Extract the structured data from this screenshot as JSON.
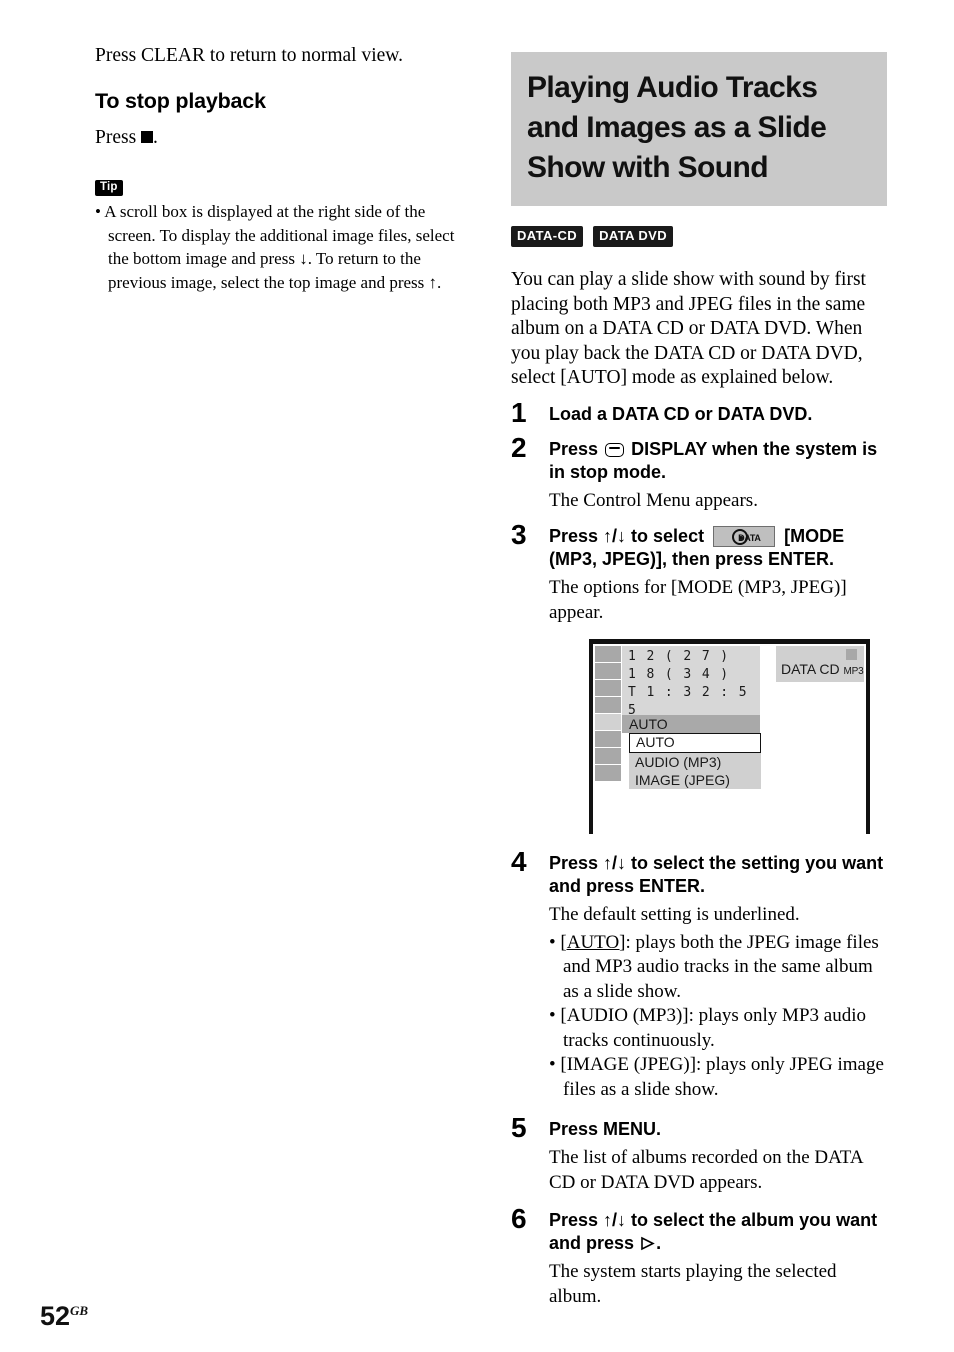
{
  "left_column": {
    "intro_line": "Press CLEAR to return to normal view.",
    "subhead": "To stop playback",
    "press_prefix": "Press",
    "press_suffix": ".",
    "tip_badge": "Tip",
    "tip_items": [
      "A scroll box is displayed at the right side of the screen. To display the additional image files, select the bottom image and press ↓. To return to the previous image, select the top image and press ↑."
    ]
  },
  "right_column": {
    "section_title": "Playing Audio Tracks and Images as a Slide Show with Sound",
    "disc_badges": [
      "DATA-CD",
      "DATA DVD"
    ],
    "intro": "You can play a slide show with sound by first placing both MP3 and JPEG files in the same album on a DATA CD or DATA DVD. When you play back the DATA CD or DATA DVD, select [AUTO] mode as explained below.",
    "steps": [
      {
        "num": "1",
        "title": "Load a DATA CD or DATA DVD."
      },
      {
        "num": "2",
        "title_before_icon": "Press",
        "icon": "display-button-icon",
        "title_after_icon": "DISPLAY when the system is in stop mode.",
        "body": "The Control Menu appears."
      },
      {
        "num": "3",
        "title_before_icon": "Press ↑/↓ to select",
        "icon": "data-mode-chip-icon",
        "chip_label": "DATA",
        "title_after_icon": "[MODE (MP3, JPEG)], then press ENTER.",
        "body": "The options for [MODE (MP3, JPEG)] appear."
      },
      {
        "num": "4",
        "title": "Press ↑/↓ to select the setting you want and press ENTER.",
        "body": "The default setting is underlined.",
        "bullets": [
          {
            "term": "[AUTO]",
            "underlined": true,
            "text": ": plays both the JPEG image files and MP3 audio tracks in the same album as a slide show."
          },
          {
            "term": "[AUDIO (MP3)]",
            "underlined": false,
            "text": ": plays only MP3 audio tracks continuously."
          },
          {
            "term": "[IMAGE (JPEG)]",
            "underlined": false,
            "text": ": plays only JPEG image files as a slide show."
          }
        ]
      },
      {
        "num": "5",
        "title": "Press MENU.",
        "body": "The list of albums recorded on the DATA CD or DATA DVD appears."
      },
      {
        "num": "6",
        "title_before_icon": "Press ↑/↓ to select the album you want and press",
        "icon": "play-outline-icon",
        "title_after_icon": ".",
        "body": "The system starts playing the selected album."
      }
    ]
  },
  "tv_screen": {
    "icon_column_count": 8,
    "icon_column_selected_index": 4,
    "info_lines": [
      "1 2 ( 2 7 )",
      "1 8 ( 3 4 )",
      "T    1 : 3 2 : 5 5"
    ],
    "current_setting_bar": "AUTO",
    "menu_options": [
      "AUTO",
      "AUDIO (MP3)",
      "IMAGE (JPEG)"
    ],
    "menu_highlighted_index": 0,
    "disc_type_label": "DATA CD",
    "disc_format_label": "MP3"
  },
  "footer": {
    "page_number": "52",
    "page_suffix": "GB"
  },
  "colors": {
    "banner_bg": "#c9c9c9",
    "badge_bg": "#1a1a1a",
    "osd_gray_dark": "#a8a8a8",
    "osd_gray_light": "#d0d0d0"
  }
}
